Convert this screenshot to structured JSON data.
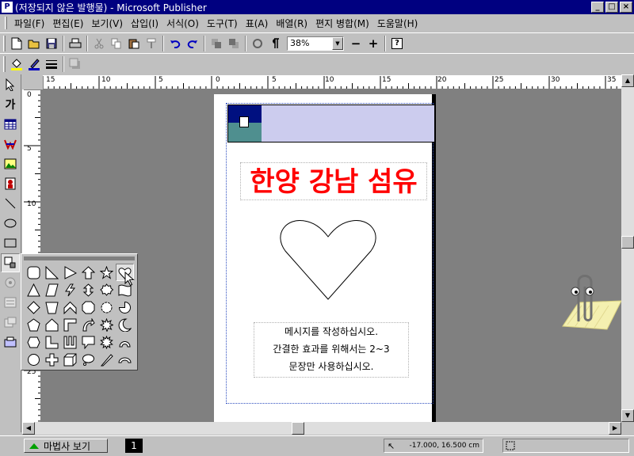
{
  "titlebar": {
    "icon_label": "P",
    "title": "(저장되지 않은 발행물) - Microsoft Publisher",
    "min": "_",
    "max": "□",
    "close": "×"
  },
  "menu": [
    "파일(F)",
    "편집(E)",
    "보기(V)",
    "삽입(I)",
    "서식(O)",
    "도구(T)",
    "표(A)",
    "배열(R)",
    "편지 병합(M)",
    "도움말(H)"
  ],
  "toolbar": {
    "zoom_value": "38%",
    "zoom_minus": "−",
    "zoom_plus": "+",
    "help": "?"
  },
  "ruler": {
    "h_labels": [
      "15",
      "10",
      "5",
      "0",
      "5",
      "10",
      "15",
      "20",
      "25",
      "30",
      "35"
    ],
    "v_labels": [
      "0",
      "5",
      "10",
      "15",
      "20",
      "25"
    ]
  },
  "document": {
    "heading": "한양 강남 섬유",
    "body_lines": [
      "메시지를 작성하십시오.",
      "간결한 효과를 위해서는 2~3",
      "문장만 사용하십시오."
    ]
  },
  "statusbar": {
    "wizard_label": "마법사 보기",
    "page_number": "1",
    "coordinates": "-17.000, 16.500 cm"
  },
  "colors": {
    "title_bar": "#000080",
    "heading_text": "#ff0000",
    "header_box": "#ccccee",
    "workspace": "#808080",
    "chrome": "#c0c0c0"
  },
  "icons": {
    "left_tools": [
      "pointer-icon",
      "text-tool-icon",
      "table-tool-icon",
      "wordart-icon",
      "picture-icon",
      "clipart-icon",
      "line-icon",
      "oval-icon",
      "rectangle-icon",
      "custom-shapes-icon",
      "design-gallery-icon",
      "form-control-icon",
      "html-code-icon",
      "object-icon"
    ]
  }
}
